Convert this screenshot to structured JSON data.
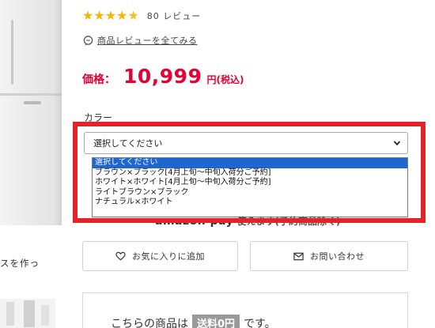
{
  "rating": {
    "stars": "★★★★",
    "half_star": "★",
    "count_text": "80 レビュー",
    "value": 4.5
  },
  "review_link": "商品レビューを全てみる",
  "price": {
    "label": "価格：",
    "value": "10,999",
    "tax": "円(税込)"
  },
  "color": {
    "label": "カラー",
    "selected": "選択してください",
    "options": [
      "選択してください",
      "ブラウン×ブラック[4月上旬～中旬入荷分ご予約]",
      "ホワイト×ホワイト[4月上旬～中旬入荷分ご予約]",
      "ライトブラウン×ブラック",
      "ナチュラル×ホワイト"
    ]
  },
  "amazon": {
    "logo": "amazon pay",
    "text": "使えます(予約商品除く)"
  },
  "buttons": {
    "favorite": "お気に入りに追加",
    "contact": "お問い合わせ"
  },
  "shipping": {
    "prefix": "こちらの商品は",
    "badge": "送料0円",
    "suffix": "です。"
  },
  "left": {
    "caption": "スを作っ"
  },
  "colors": {
    "accent": "#e60033",
    "star": "#f7b500",
    "highlight": "#e3222a",
    "selection": "#1e66d0"
  }
}
